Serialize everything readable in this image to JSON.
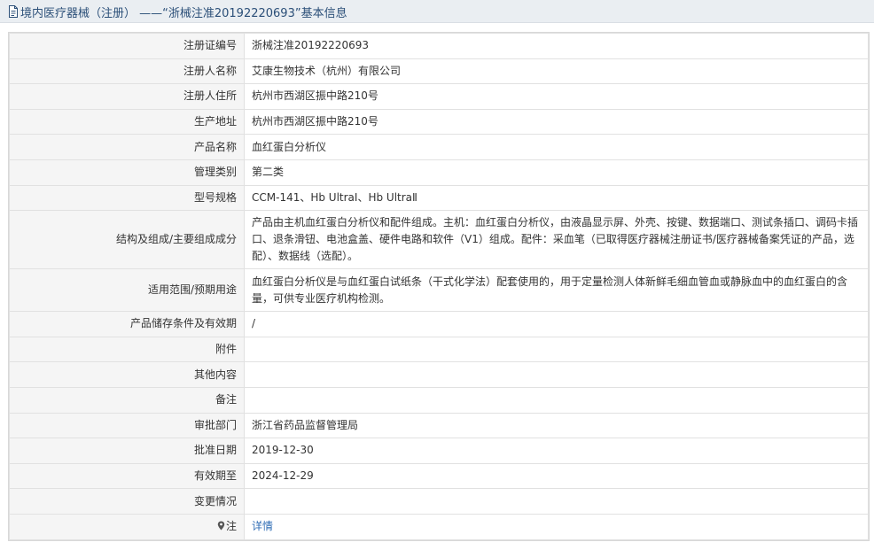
{
  "header": {
    "title": "境内医疗器械（注册） ——“浙械注准20192220693”基本信息"
  },
  "rows": [
    {
      "label": "注册证编号",
      "value": "浙械注准20192220693"
    },
    {
      "label": "注册人名称",
      "value": "艾康生物技术（杭州）有限公司"
    },
    {
      "label": "注册人住所",
      "value": "杭州市西湖区振中路210号"
    },
    {
      "label": "生产地址",
      "value": "杭州市西湖区振中路210号"
    },
    {
      "label": "产品名称",
      "value": "血红蛋白分析仪"
    },
    {
      "label": "管理类别",
      "value": "第二类"
    },
    {
      "label": "型号规格",
      "value": "CCM-141、Hb UltraⅠ、Hb UltraⅡ"
    },
    {
      "label": "结构及组成/主要组成成分",
      "value": "产品由主机血红蛋白分析仪和配件组成。主机：血红蛋白分析仪，由液晶显示屏、外壳、按键、数据端口、测试条插口、调码卡插口、退条滑钮、电池盒盖、硬件电路和软件（V1）组成。配件：采血笔（已取得医疗器械注册证书/医疗器械备案凭证的产品，选配）、数据线（选配）。"
    },
    {
      "label": "适用范围/预期用途",
      "value": "血红蛋白分析仪是与血红蛋白试纸条（干式化学法）配套使用的，用于定量检测人体新鲜毛细血管血或静脉血中的血红蛋白的含量，可供专业医疗机构检测。"
    },
    {
      "label": "产品储存条件及有效期",
      "value": "/"
    },
    {
      "label": "附件",
      "value": ""
    },
    {
      "label": "其他内容",
      "value": ""
    },
    {
      "label": "备注",
      "value": ""
    },
    {
      "label": "审批部门",
      "value": "浙江省药品监督管理局"
    },
    {
      "label": "批准日期",
      "value": "2019-12-30"
    },
    {
      "label": "有效期至",
      "value": "2024-12-29"
    },
    {
      "label": "变更情况",
      "value": ""
    }
  ],
  "note_row": {
    "label": "注",
    "link_text": "详情",
    "icon": "pin-icon"
  },
  "colors": {
    "header_bg": "#eaeef2",
    "header_text": "#2b4f78",
    "label_bg": "#f5f5f5",
    "link": "#2f6db5"
  }
}
